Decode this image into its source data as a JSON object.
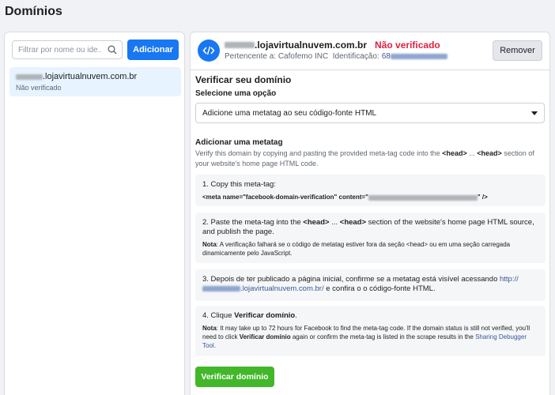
{
  "page": {
    "title": "Domínios"
  },
  "sidebar": {
    "search_placeholder": "Filtrar por nome ou ide...",
    "add_label": "Adicionar",
    "items": [
      {
        "domain_suffix": ".lojavirtualnuvem.com.br",
        "status": "Não verificado"
      }
    ]
  },
  "detail": {
    "domain_suffix": ".lojavirtualnuvem.com.br",
    "status": "Não verificado",
    "owner_label": "Pertencente a:",
    "owner": "Cafofemo INC",
    "id_label": "Identificação:",
    "id_prefix": "68",
    "remove_label": "Remover",
    "verify_title": "Verificar seu domínio",
    "option_label": "Selecione uma opção",
    "option_value": "Adicione uma metatag ao seu código-fonte HTML",
    "metatag_title": "Adicionar uma metatag",
    "metatag_desc_1": "Verify this domain by copying and pasting the provided meta-tag code into the ",
    "metatag_desc_head1": "<head>",
    "metatag_desc_2": " ... ",
    "metatag_desc_head2": "<head>",
    "metatag_desc_3": " section of your website's home page HTML code.",
    "step1_text": "1. Copy this meta-tag:",
    "step1_code_start": "<meta name=\"facebook-domain-verification\" content=\"",
    "step1_code_end": "\" />",
    "step2_a": "2. Paste the meta-tag into the ",
    "step2_head1": "<head>",
    "step2_b": " ... ",
    "step2_head2": "<head>",
    "step2_c": " section of the website's home page HTML source, and publish the page.",
    "step2_note_label": "Nota",
    "step2_note": ": A verificação falhará se o código de metatag estiver fora da seção <head> ou em uma seção carregada dinamicamente pelo JavaScript.",
    "step3_a": "3. Depois de ter publicado a página inicial, confirme se a metatag está visível acessando ",
    "step3_link_prefix": "http://",
    "step3_link_suffix": ".lojavirtualnuvem.com.br/",
    "step3_b": " e confira o o código-fonte HTML.",
    "step4_a": "4. Clique ",
    "step4_bold": "Verificar domínio",
    "step4_b": ".",
    "step4_note_label": "Nota",
    "step4_note_a": ": It may take up to 72 hours for Facebook to find the meta-tag code. If the domain status is still not verified, you'll need to click ",
    "step4_note_bold": "Verificar domínio",
    "step4_note_b": " again or confirm the meta-tag is listed in the scrape results in the ",
    "step4_note_link": "Sharing Debugger Tool",
    "step4_note_c": ".",
    "verify_button": "Verificar domínio"
  },
  "colors": {
    "accent": "#1877f2",
    "error": "#e41e3f",
    "success": "#42b72a",
    "link": "#385898"
  },
  "icons": {
    "search": "search-icon",
    "code": "code-icon",
    "dropdown": "chevron-down-icon"
  }
}
